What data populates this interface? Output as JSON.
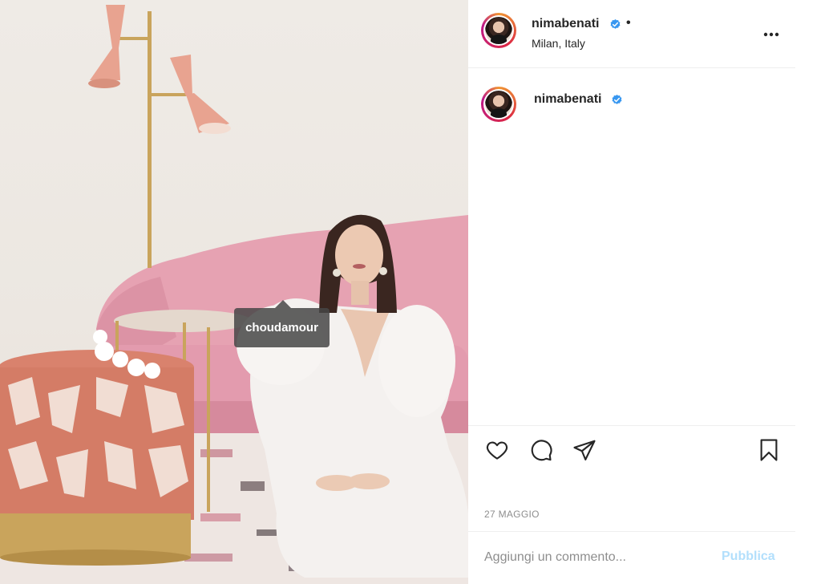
{
  "post": {
    "photo_tag": "choudamour",
    "author": {
      "username": "nimabenati",
      "separator": "•",
      "location": "Milan, Italy"
    },
    "caption": {
      "username": "nimabenati"
    },
    "date": "27 MAGGIO",
    "comment": {
      "placeholder": "Aggiungi un commento...",
      "value": "",
      "publish_label": "Pubblica"
    }
  },
  "icons": {
    "more": "more-options-icon",
    "like": "heart-icon",
    "comment": "comment-icon",
    "share": "paper-plane-icon",
    "save": "bookmark-icon",
    "verified": "verified-badge-icon"
  },
  "colors": {
    "verified_blue": "#3897f0",
    "publish_disabled": "#b2dffc",
    "muted_text": "#8e8e8e",
    "primary_text": "#262626"
  }
}
